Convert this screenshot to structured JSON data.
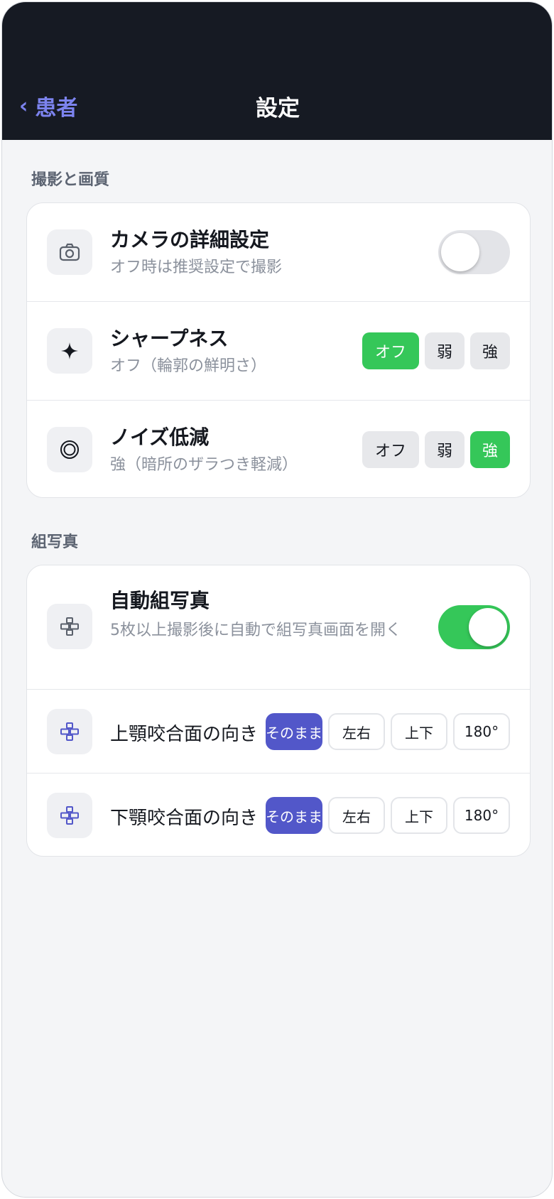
{
  "header": {
    "back_label": "患者",
    "back_chevron": "‹",
    "title": "設定"
  },
  "sections": {
    "capture": {
      "label": "撮影と画質",
      "camera": {
        "title": "カメラの詳細設定",
        "subtitle": "オフ時は推奨設定で撮影",
        "enabled": false,
        "icon": "camera-icon"
      },
      "sharpness": {
        "title": "シャープネス",
        "subtitle": "オフ（輪郭の鮮明さ）",
        "icon": "sparkle-icon",
        "options": [
          "オフ",
          "弱",
          "強"
        ],
        "selected": "オフ"
      },
      "noise": {
        "title": "ノイズ低減",
        "subtitle": "強（暗所のザラつき軽減）",
        "icon": "concentric-circle-icon",
        "options": [
          "オフ",
          "弱",
          "強"
        ],
        "selected": "強"
      }
    },
    "collage": {
      "label": "組写真",
      "auto": {
        "title": "自動組写真",
        "subtitle": "5枚以上撮影後に自動で組写真画面を開く",
        "enabled": true,
        "icon": "grid-cross-icon"
      },
      "upper": {
        "title": "上顎咬合面の向き",
        "icon": "grid-cross-icon",
        "options": [
          "そのまま",
          "左右",
          "上下",
          "180°"
        ],
        "selected": "そのまま"
      },
      "lower": {
        "title": "下顎咬合面の向き",
        "icon": "grid-cross-icon",
        "options": [
          "そのまま",
          "左右",
          "上下",
          "180°"
        ],
        "selected": "そのまま"
      }
    }
  },
  "colors": {
    "accent_green": "#35c759",
    "accent_blue": "#5257c9",
    "back_link": "#7c83ee",
    "header_bg": "#161a23"
  }
}
